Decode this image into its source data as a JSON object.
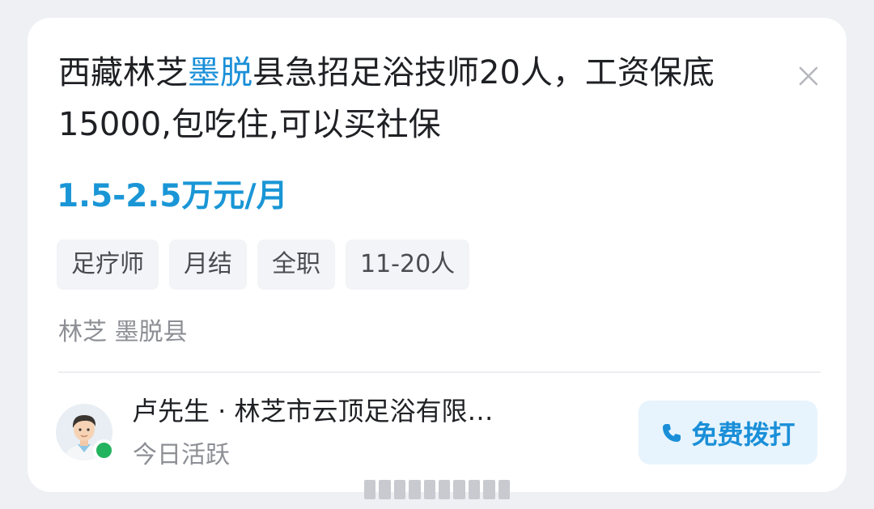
{
  "job": {
    "title_pre": "西藏林芝",
    "title_highlight": "墨脱",
    "title_post": "县急招足浴技师20人，工资保底15000,包吃住,可以买社保",
    "salary": "1.5-2.5万元/月",
    "tags": [
      "足疗师",
      "月结",
      "全职",
      "11-20人"
    ],
    "location": "林芝 墨脱县"
  },
  "recruiter": {
    "contact_line": "卢先生 · 林芝市云顶足浴有限…",
    "status": "今日活跃"
  },
  "actions": {
    "call_label": "免费拨打",
    "close_icon": "close-icon",
    "phone_icon": "phone-icon"
  },
  "colors": {
    "accent": "#1a8fd8",
    "salary": "#1a96d6",
    "online": "#22b35e",
    "button_bg": "#e7f4fd"
  }
}
